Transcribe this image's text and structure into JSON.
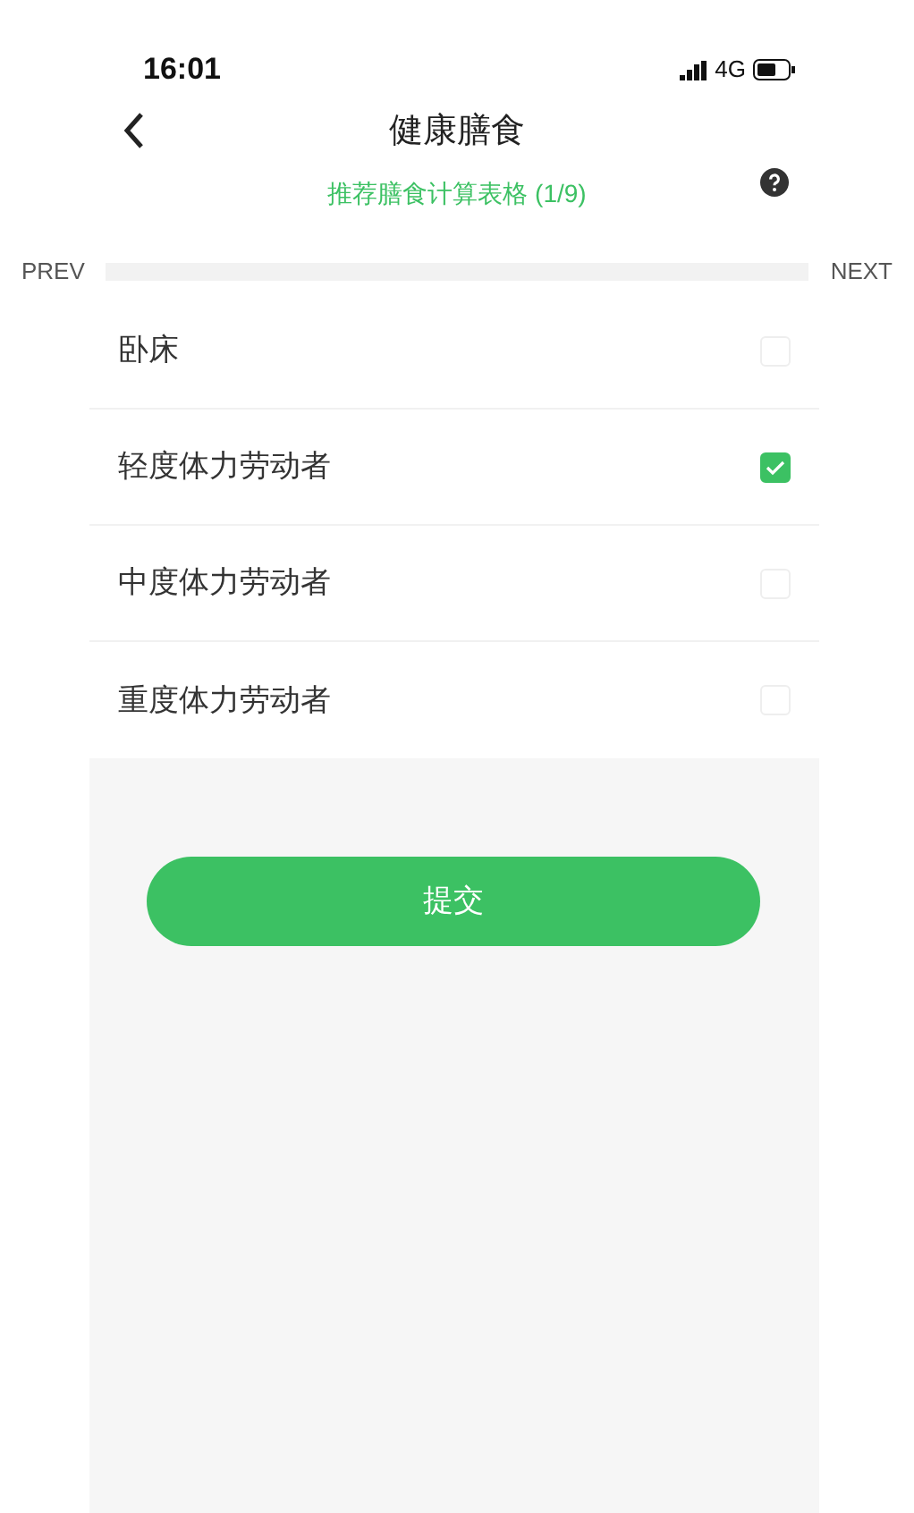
{
  "status_bar": {
    "time": "16:01",
    "network": "4G"
  },
  "header": {
    "title": "健康膳食",
    "subtitle": "推荐膳食计算表格 (1/9)"
  },
  "pager": {
    "prev": "PREV",
    "next": "NEXT"
  },
  "options": [
    {
      "label": "卧床",
      "checked": false
    },
    {
      "label": "轻度体力劳动者",
      "checked": true
    },
    {
      "label": "中度体力劳动者",
      "checked": false
    },
    {
      "label": "重度体力劳动者",
      "checked": false
    }
  ],
  "submit": "提交"
}
